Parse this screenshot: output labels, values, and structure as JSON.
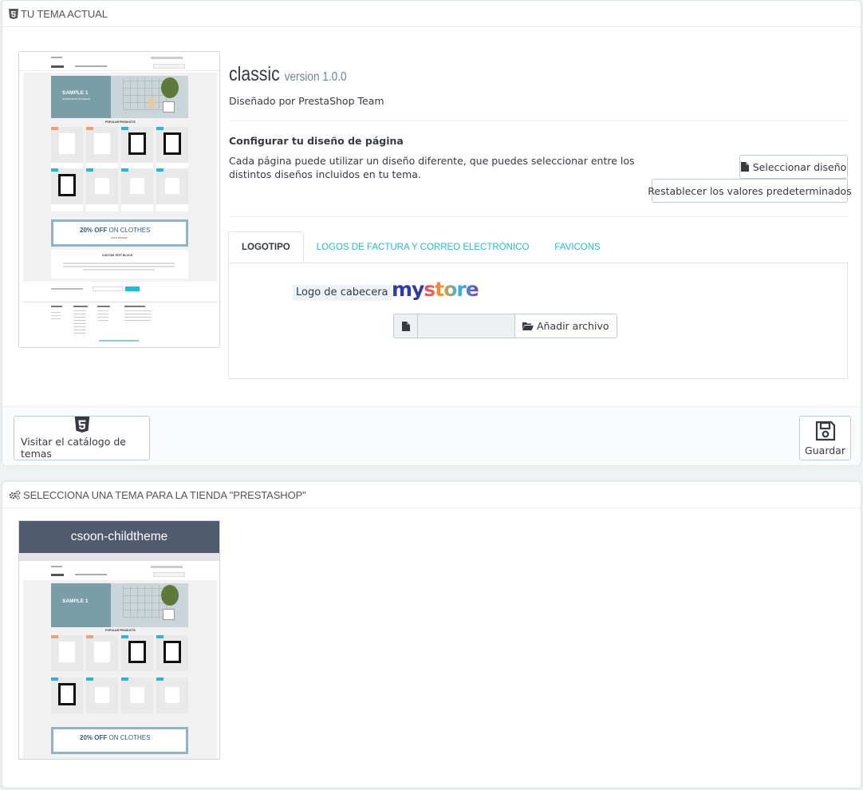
{
  "current_theme_panel": {
    "heading": "TU TEMA ACTUAL",
    "theme_name": "classic",
    "theme_version": "version 1.0.0",
    "author": "Diseñado por PrestaShop Team",
    "layout_title": "Configurar tu diseño de página",
    "layout_desc": "Cada página puede utilizar un diseño diferente, que puedes seleccionar entre los distintos diseños incluidos en tu tema.",
    "select_layout_button": "Seleccionar diseño",
    "reset_button": "Restablecer los valores predeterminados",
    "tabs": [
      {
        "label": "LOGOTIPO",
        "active": true
      },
      {
        "label": "LOGOS DE FACTURA Y CORREO ELECTRÓNICO",
        "active": false
      },
      {
        "label": "FAVICONS",
        "active": false
      }
    ],
    "logo_label": "Logo de cabecera",
    "logo_text_my": "my",
    "logo_text_store": "store",
    "add_file_button": "Añadir archivo",
    "catalog_button": "Visitar el catálogo de temas",
    "save_button": "Guardar",
    "preview": {
      "banner_title": "SAMPLE 1",
      "banner_subtitle": "EXCEPTEUR OCCAECAT",
      "popular": "POPULAR PRODUCTS",
      "promo_prefix": "20% OFF",
      "promo_suffix": "ON CLOTHES",
      "promo_code": "SAVE WINNER",
      "custom_block": "CUSTOM TEXT BLOCK"
    }
  },
  "select_theme_panel": {
    "heading": "SELECCIONA UNA TEMA PARA LA TIENDA \"PRESTASHOP\"",
    "theme_card_title": "csoon-childtheme"
  },
  "colors": {
    "accent": "#25b9d7",
    "card_header": "#505b70",
    "banner": "#7a9ea8"
  }
}
